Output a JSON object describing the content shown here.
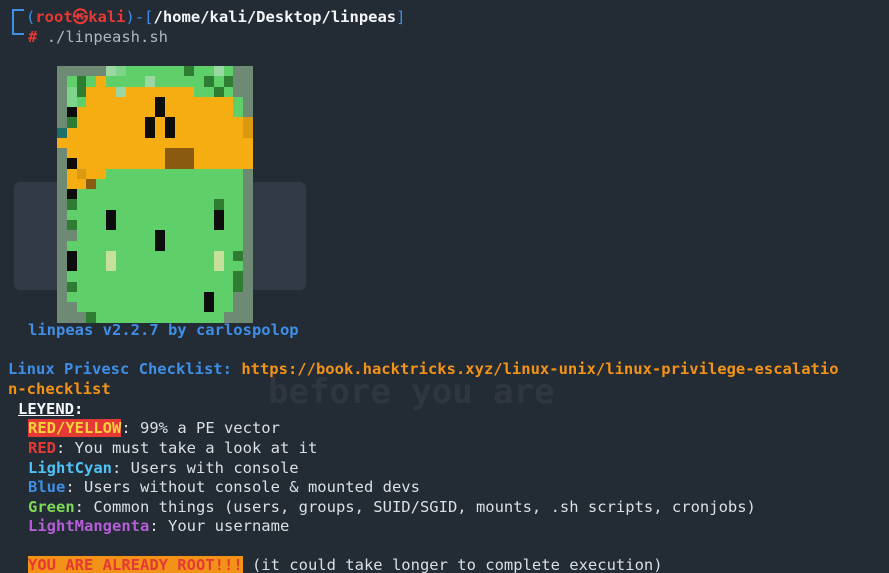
{
  "prompt": {
    "open_paren": "(",
    "user": "root",
    "at_symbol": "㉿",
    "host": "kali",
    "close_dash": ")-[",
    "cwd": "/home/kali/Desktop/linpeas",
    "close_bracket": "]",
    "hash": "#",
    "command": "./linpeash.sh"
  },
  "banner": {
    "version_line": "linpeas v2.2.7 by carlospolop"
  },
  "checklist": {
    "label": "Linux Privesc Checklist:",
    "url_part1": "https://book.hacktricks.xyz/linux-unix/linux-privilege-escalatio",
    "url_part2": "n-checklist"
  },
  "legend": {
    "title": "LEYEND",
    "colon": ":",
    "items": [
      {
        "key": "RED/YELLOW",
        "desc": ": 99% a PE vector"
      },
      {
        "key": "RED",
        "desc": ": You must take a look at it"
      },
      {
        "key": "LightCyan",
        "desc": ": Users with console"
      },
      {
        "key": "Blue",
        "desc": ": Users without console & mounted devs"
      },
      {
        "key": "Green",
        "desc": ": Common things (users, groups, SUID/SGID, mounts, .sh scripts, cronjobs)"
      },
      {
        "key": "LightMangenta",
        "desc": ": Your username"
      }
    ]
  },
  "root_notice": {
    "label": "YOU ARE ALREADY ROOT!!!",
    "desc": " (it could take longer to complete execution)"
  },
  "watermark_text": "before you are",
  "colors": {
    "background": "#232b35",
    "prompt_blue": "#3f8fe6",
    "red": "#e53935",
    "orange": "#f29318",
    "yellow": "#f6d23a",
    "light_cyan": "#4fc3f7",
    "green": "#7ed957",
    "light_magenta": "#b55fd6"
  },
  "logo_palette": {
    "G": "#5fcf6a",
    "g": "#7fd48b",
    "L": "#9ad7a2",
    "D": "#2e7d32",
    "d": "#1b5e20",
    "K": "#0d0d0d",
    "O": "#f5ad12",
    "o": "#d99a0f",
    "B": "#8a5a10",
    "T": "#1e6f6a",
    "Y": "#c6df9a",
    "S": "#6e8a75",
    "W": "#b9e0bf"
  },
  "logo_rows": [
    "SSSSSLgGGGGGGDGGLGSS",
    "SGDGOGGGGLGGGGGDGDSS",
    "SgDOOOLOOOOOOOGGDGSS",
    "SgGOOOOOOOKOOOOOOOGS",
    "SKOOOOOOOOKOOOOOOOGS",
    "SDOOOOOOOKOKOOOOOOOo",
    "TOOOOOOOOKOKOOOOOOOo",
    "OOOOOOOOOOOOOOOOOOOO",
    "SOOOOOOOOOOBBBOOOOOO",
    "SKOOOOOOOOOBBBOOOOOO",
    "SOoOOGGGGGGGGGGGGGGS",
    "SOOBGGGGGGGGGGGGGGGS",
    "SKGGGGGGGGGGGGGGGGGS",
    "SDGGGGGGGGGGGGGGDGGS",
    "SGGGGKGGGGGGGGGGKGGS",
    "SDGGGKGGGGGGGGGGKGGS",
    "SSGGGGGGGGKGGGGGGGGS",
    "SGGGGGGGGGKGGGGGGGGS",
    "SKGGGYGGGGGGGGGGYGDS",
    "SKGGGYGGGGGGGGGGYGGS",
    "SGGGGGGGGGGGGGGGGGDS",
    "SDGGGGGGGGGGGGGGGGDS",
    "SGGGGGGGGGGGGGGKGGSS",
    "SSGGGGGGGGGGGGGKGGSS",
    "SSSDGGGGGGGGGGGGGSSS"
  ]
}
